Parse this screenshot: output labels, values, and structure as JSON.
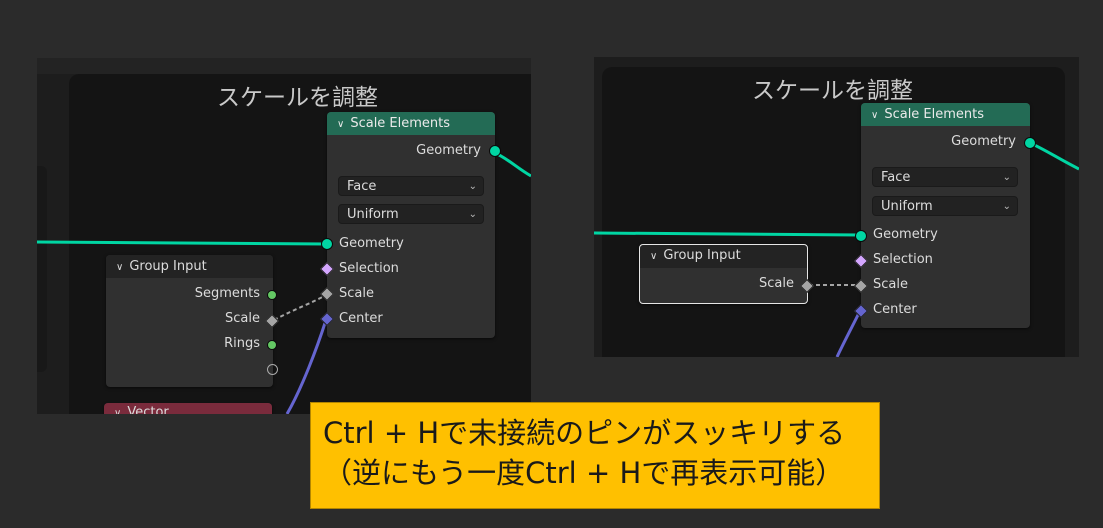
{
  "left": {
    "frame_title": "スケールを調整",
    "scale_node": {
      "title": "Scale Elements",
      "output_geometry": "Geometry",
      "domain": "Face",
      "mode": "Uniform",
      "inputs": [
        "Geometry",
        "Selection",
        "Scale",
        "Center"
      ]
    },
    "group_input": {
      "title": "Group Input",
      "outputs": [
        "Segments",
        "Scale",
        "Rings"
      ]
    },
    "vector_node": {
      "title": "Vector"
    }
  },
  "right": {
    "frame_title": "スケールを調整",
    "scale_node": {
      "title": "Scale Elements",
      "output_geometry": "Geometry",
      "domain": "Face",
      "mode": "Uniform",
      "inputs": [
        "Geometry",
        "Selection",
        "Scale",
        "Center"
      ]
    },
    "group_input": {
      "title": "Group Input",
      "outputs": [
        "Scale"
      ]
    }
  },
  "callout": {
    "line1": "Ctrl + Hで未接続のピンがスッキリする",
    "line2": "（逆にもう一度Ctrl + Hで再表示可能）"
  },
  "colors": {
    "geometry_socket": "#00d6a3",
    "scale_header": "#236b55",
    "vector_header": "#7a2b3c",
    "vector_wire": "#6565d0",
    "callout_bg": "#ffc000"
  },
  "icons": [
    "chevron-down-icon",
    "dropdown-arrow-icon"
  ]
}
